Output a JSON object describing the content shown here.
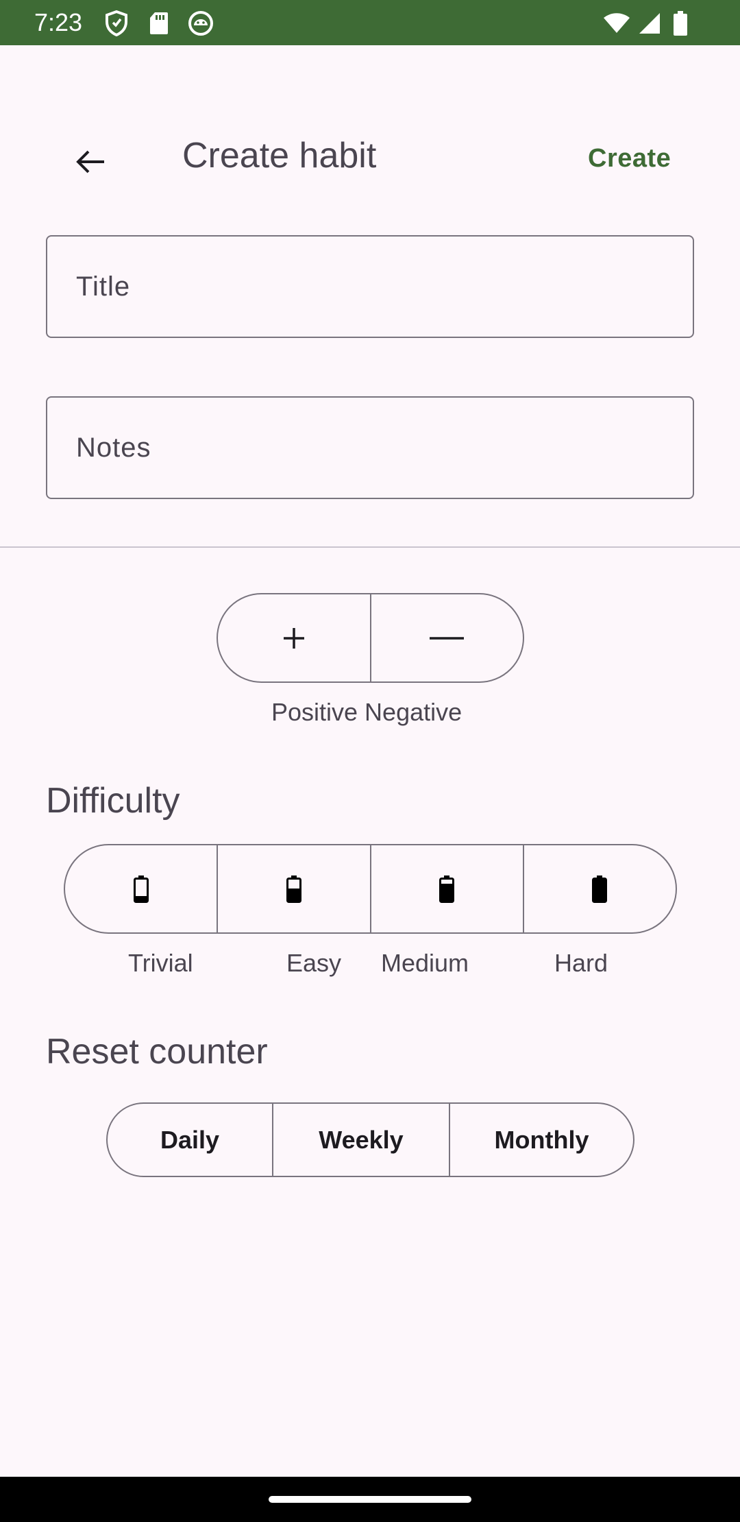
{
  "status_bar": {
    "time": "7:23",
    "background": "#3e6b35",
    "left_icons": [
      "shield-icon",
      "sd-card-icon",
      "android-debug-icon"
    ],
    "right_icons": [
      "wifi-icon",
      "cell-signal-icon",
      "battery-icon"
    ]
  },
  "app_bar": {
    "back_icon": "arrow-left-icon",
    "title": "Create habit",
    "action_label": "Create",
    "accent": "#3e6b35"
  },
  "form": {
    "title_placeholder": "Title",
    "notes_placeholder": "Notes"
  },
  "polarity": {
    "options": [
      {
        "icon": "plus-icon",
        "label": "Positive"
      },
      {
        "icon": "minus-icon",
        "label": "Negative"
      }
    ],
    "labels_text": "Positive Negative"
  },
  "difficulty": {
    "title": "Difficulty",
    "options": [
      {
        "label": "Trivial",
        "icon": "battery-low-icon",
        "level": 0.25
      },
      {
        "label": "Easy",
        "icon": "battery-half-icon",
        "level": 0.5
      },
      {
        "label": "Medium",
        "icon": "battery-three-quarter-icon",
        "level": 0.75
      },
      {
        "label": "Hard",
        "icon": "battery-full-icon",
        "level": 1.0
      }
    ]
  },
  "reset_counter": {
    "title": "Reset counter",
    "options": [
      "Daily",
      "Weekly",
      "Monthly"
    ]
  }
}
